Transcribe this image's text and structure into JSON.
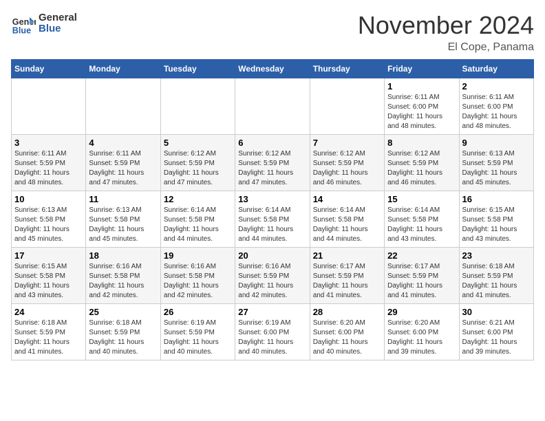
{
  "header": {
    "logo_general": "General",
    "logo_blue": "Blue",
    "month_title": "November 2024",
    "location": "El Cope, Panama"
  },
  "days_of_week": [
    "Sunday",
    "Monday",
    "Tuesday",
    "Wednesday",
    "Thursday",
    "Friday",
    "Saturday"
  ],
  "weeks": [
    [
      {
        "day": "",
        "info": ""
      },
      {
        "day": "",
        "info": ""
      },
      {
        "day": "",
        "info": ""
      },
      {
        "day": "",
        "info": ""
      },
      {
        "day": "",
        "info": ""
      },
      {
        "day": "1",
        "info": "Sunrise: 6:11 AM\nSunset: 6:00 PM\nDaylight: 11 hours\nand 48 minutes."
      },
      {
        "day": "2",
        "info": "Sunrise: 6:11 AM\nSunset: 6:00 PM\nDaylight: 11 hours\nand 48 minutes."
      }
    ],
    [
      {
        "day": "3",
        "info": "Sunrise: 6:11 AM\nSunset: 5:59 PM\nDaylight: 11 hours\nand 48 minutes."
      },
      {
        "day": "4",
        "info": "Sunrise: 6:11 AM\nSunset: 5:59 PM\nDaylight: 11 hours\nand 47 minutes."
      },
      {
        "day": "5",
        "info": "Sunrise: 6:12 AM\nSunset: 5:59 PM\nDaylight: 11 hours\nand 47 minutes."
      },
      {
        "day": "6",
        "info": "Sunrise: 6:12 AM\nSunset: 5:59 PM\nDaylight: 11 hours\nand 47 minutes."
      },
      {
        "day": "7",
        "info": "Sunrise: 6:12 AM\nSunset: 5:59 PM\nDaylight: 11 hours\nand 46 minutes."
      },
      {
        "day": "8",
        "info": "Sunrise: 6:12 AM\nSunset: 5:59 PM\nDaylight: 11 hours\nand 46 minutes."
      },
      {
        "day": "9",
        "info": "Sunrise: 6:13 AM\nSunset: 5:59 PM\nDaylight: 11 hours\nand 45 minutes."
      }
    ],
    [
      {
        "day": "10",
        "info": "Sunrise: 6:13 AM\nSunset: 5:58 PM\nDaylight: 11 hours\nand 45 minutes."
      },
      {
        "day": "11",
        "info": "Sunrise: 6:13 AM\nSunset: 5:58 PM\nDaylight: 11 hours\nand 45 minutes."
      },
      {
        "day": "12",
        "info": "Sunrise: 6:14 AM\nSunset: 5:58 PM\nDaylight: 11 hours\nand 44 minutes."
      },
      {
        "day": "13",
        "info": "Sunrise: 6:14 AM\nSunset: 5:58 PM\nDaylight: 11 hours\nand 44 minutes."
      },
      {
        "day": "14",
        "info": "Sunrise: 6:14 AM\nSunset: 5:58 PM\nDaylight: 11 hours\nand 44 minutes."
      },
      {
        "day": "15",
        "info": "Sunrise: 6:14 AM\nSunset: 5:58 PM\nDaylight: 11 hours\nand 43 minutes."
      },
      {
        "day": "16",
        "info": "Sunrise: 6:15 AM\nSunset: 5:58 PM\nDaylight: 11 hours\nand 43 minutes."
      }
    ],
    [
      {
        "day": "17",
        "info": "Sunrise: 6:15 AM\nSunset: 5:58 PM\nDaylight: 11 hours\nand 43 minutes."
      },
      {
        "day": "18",
        "info": "Sunrise: 6:16 AM\nSunset: 5:58 PM\nDaylight: 11 hours\nand 42 minutes."
      },
      {
        "day": "19",
        "info": "Sunrise: 6:16 AM\nSunset: 5:58 PM\nDaylight: 11 hours\nand 42 minutes."
      },
      {
        "day": "20",
        "info": "Sunrise: 6:16 AM\nSunset: 5:59 PM\nDaylight: 11 hours\nand 42 minutes."
      },
      {
        "day": "21",
        "info": "Sunrise: 6:17 AM\nSunset: 5:59 PM\nDaylight: 11 hours\nand 41 minutes."
      },
      {
        "day": "22",
        "info": "Sunrise: 6:17 AM\nSunset: 5:59 PM\nDaylight: 11 hours\nand 41 minutes."
      },
      {
        "day": "23",
        "info": "Sunrise: 6:18 AM\nSunset: 5:59 PM\nDaylight: 11 hours\nand 41 minutes."
      }
    ],
    [
      {
        "day": "24",
        "info": "Sunrise: 6:18 AM\nSunset: 5:59 PM\nDaylight: 11 hours\nand 41 minutes."
      },
      {
        "day": "25",
        "info": "Sunrise: 6:18 AM\nSunset: 5:59 PM\nDaylight: 11 hours\nand 40 minutes."
      },
      {
        "day": "26",
        "info": "Sunrise: 6:19 AM\nSunset: 5:59 PM\nDaylight: 11 hours\nand 40 minutes."
      },
      {
        "day": "27",
        "info": "Sunrise: 6:19 AM\nSunset: 6:00 PM\nDaylight: 11 hours\nand 40 minutes."
      },
      {
        "day": "28",
        "info": "Sunrise: 6:20 AM\nSunset: 6:00 PM\nDaylight: 11 hours\nand 40 minutes."
      },
      {
        "day": "29",
        "info": "Sunrise: 6:20 AM\nSunset: 6:00 PM\nDaylight: 11 hours\nand 39 minutes."
      },
      {
        "day": "30",
        "info": "Sunrise: 6:21 AM\nSunset: 6:00 PM\nDaylight: 11 hours\nand 39 minutes."
      }
    ]
  ]
}
